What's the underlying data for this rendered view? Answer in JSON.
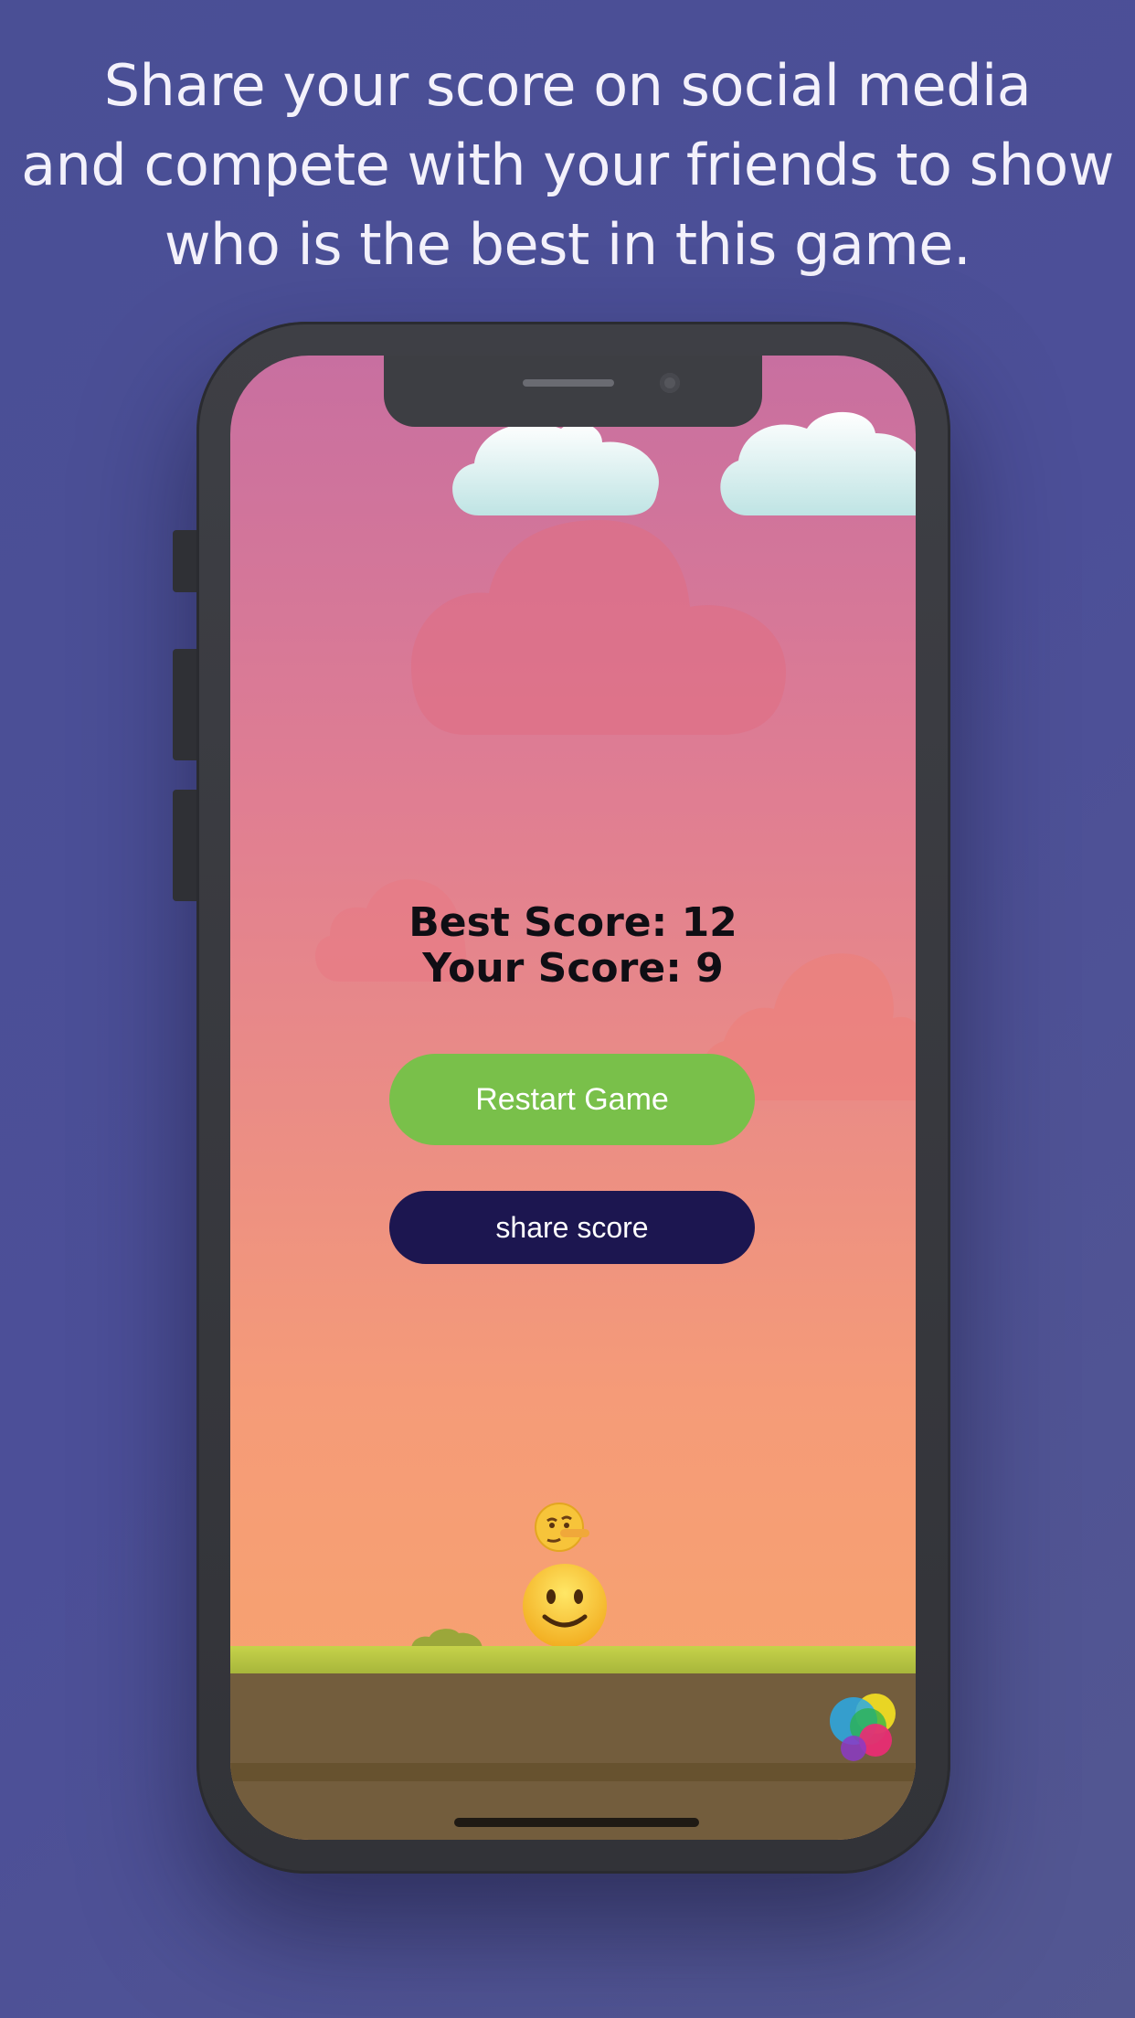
{
  "headline": "Share your score on social media\nand compete with your friends to show\nwho is the best in this game.",
  "game": {
    "best_score": "Best Score: 12",
    "your_score": "Your Score: 9",
    "restart_label": "Restart Game",
    "share_label": "share score"
  },
  "colors": {
    "background": "#4b4f96",
    "restart_button": "#79c04a",
    "share_button": "#1c1650",
    "grass": "#c6d24a",
    "dirt": "#735d3d"
  },
  "icons": [
    "lying-face-emoji",
    "smiling-face-emoji",
    "game-center-icon"
  ]
}
